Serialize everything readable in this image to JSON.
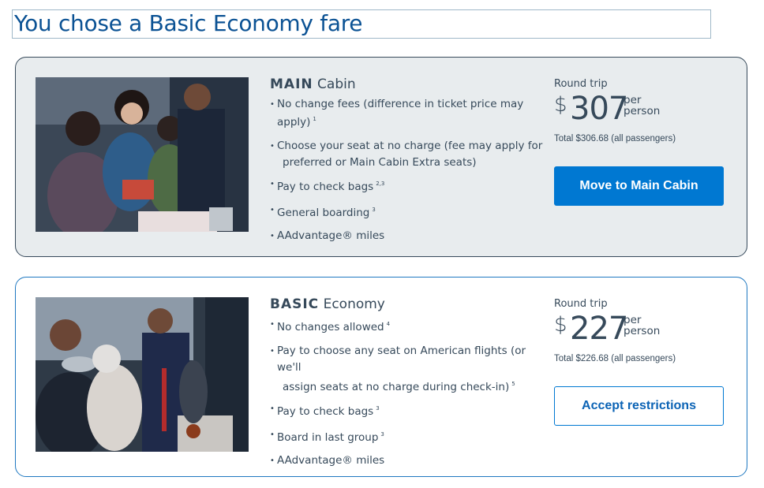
{
  "page": {
    "title": "You chose a Basic Economy fare"
  },
  "main": {
    "cabin_bold": "MAIN",
    "cabin_rest": " Cabin",
    "features": [
      {
        "text": "No change fees (difference in ticket price may apply)",
        "sup": "1"
      },
      {
        "text": "Choose your seat at no charge (fee may apply for",
        "text2": "preferred or Main Cabin Extra seats)",
        "sup": ""
      },
      {
        "text": "Pay to check bags",
        "sup": "2,3"
      },
      {
        "text": "General boarding",
        "sup": "3"
      },
      {
        "text": "AAdvantage® miles",
        "sup": ""
      }
    ],
    "round_trip": "Round trip",
    "currency": "$",
    "amount": "307",
    "per_1": "per",
    "per_2": "person",
    "total": "Total $306.68 (all passengers)",
    "button_label": "Move to Main Cabin"
  },
  "basic": {
    "cabin_bold": "BASIC",
    "cabin_rest": " Economy",
    "features": [
      {
        "text": "No changes allowed",
        "sup": "4"
      },
      {
        "text": "Pay to choose any seat on American flights (or we'll",
        "text2": "assign seats at no charge during check-in)",
        "sup": "5"
      },
      {
        "text": "Pay to check bags",
        "sup": "3"
      },
      {
        "text": "Board in last group",
        "sup": "3"
      },
      {
        "text": "AAdvantage® miles",
        "sup": ""
      }
    ],
    "round_trip": "Round trip",
    "currency": "$",
    "amount": "227",
    "per_1": "per",
    "per_2": "person",
    "total": "Total $226.68 (all passengers)",
    "button_label": "Accept restrictions"
  },
  "colors": {
    "brand_blue": "#0078d2",
    "text_dark": "#36495a",
    "title_blue": "#0b5294"
  }
}
